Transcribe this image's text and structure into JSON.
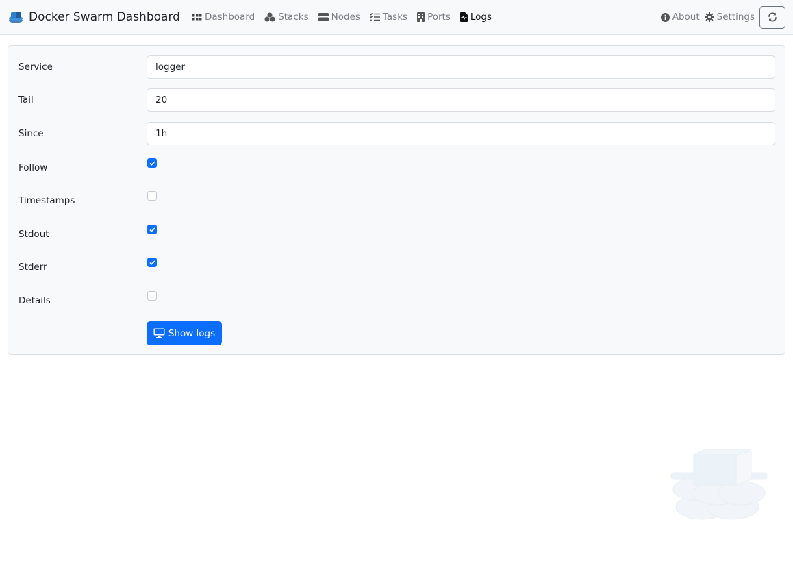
{
  "navbar": {
    "brand": "Docker Swarm Dashboard",
    "items": [
      {
        "label": "Dashboard",
        "icon": "grid-icon",
        "active": false
      },
      {
        "label": "Stacks",
        "icon": "cubes-icon",
        "active": false
      },
      {
        "label": "Nodes",
        "icon": "server-icon",
        "active": false
      },
      {
        "label": "Tasks",
        "icon": "tasks-icon",
        "active": false
      },
      {
        "label": "Ports",
        "icon": "building-icon",
        "active": false
      },
      {
        "label": "Logs",
        "icon": "file-waveform-icon",
        "active": true
      }
    ],
    "right_items": [
      {
        "label": "About",
        "icon": "info-circle-icon"
      },
      {
        "label": "Settings",
        "icon": "gear-icon"
      }
    ],
    "refresh_icon": "refresh-icon"
  },
  "form": {
    "fields": [
      {
        "label": "Service",
        "value": "logger"
      },
      {
        "label": "Tail",
        "value": "20"
      },
      {
        "label": "Since",
        "value": "1h"
      }
    ],
    "checkboxes": [
      {
        "label": "Follow",
        "checked": true
      },
      {
        "label": "Timestamps",
        "checked": false
      },
      {
        "label": "Stdout",
        "checked": true
      },
      {
        "label": "Stderr",
        "checked": true
      },
      {
        "label": "Details",
        "checked": false
      }
    ],
    "submit_label": "Show logs",
    "submit_icon": "desktop-icon"
  },
  "colors": {
    "primary": "#0d6efd",
    "navbar_bg": "#f8f9fa"
  }
}
